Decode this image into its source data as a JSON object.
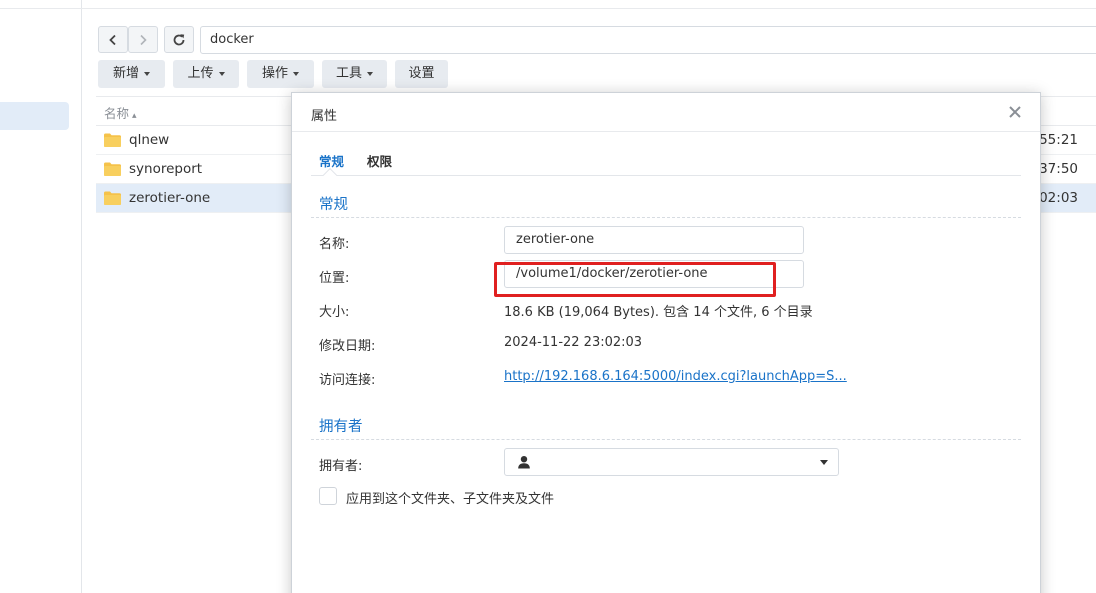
{
  "navigation": {
    "path": "docker"
  },
  "toolbar": {
    "new_label": "新增",
    "upload_label": "上传",
    "action_label": "操作",
    "tools_label": "工具",
    "settings_label": "设置"
  },
  "file_list": {
    "column_name": "名称",
    "sort_indicator": "▴",
    "rows": [
      {
        "name": "qlnew",
        "time": "55:21",
        "icon": "folder-icon"
      },
      {
        "name": "synoreport",
        "time": "37:50",
        "icon": "folder-icon"
      },
      {
        "name": "zerotier-one",
        "time": "02:03",
        "icon": "folder-icon",
        "selected": true
      }
    ]
  },
  "dialog": {
    "title": "属性",
    "close_icon": "close-icon",
    "tabs": [
      {
        "label": "常规",
        "active": true
      },
      {
        "label": "权限",
        "active": false
      }
    ],
    "general": {
      "section_title": "常规",
      "name_label": "名称:",
      "name_value": "zerotier-one",
      "location_label": "位置:",
      "location_value": "/volume1/docker/zerotier-one",
      "size_label": "大小:",
      "size_value": "18.6 KB (19,064 Bytes). 包含 14 个文件,  6 个目录",
      "modified_label": "修改日期:",
      "modified_value": "2024-11-22 23:02:03",
      "link_label": "访问连接:",
      "link_value": "http://192.168.6.164:5000/index.cgi?launchApp=S..."
    },
    "owner": {
      "section_title": "拥有者",
      "owner_label": "拥有者:",
      "owner_value": "",
      "apply_label": "应用到这个文件夹、子文件夹及文件",
      "apply_checked": false
    }
  },
  "colors": {
    "accent": "#1a73c8",
    "highlight_box": "#e02020",
    "selected_row": "#e2ecf8",
    "folder": "#f5c24a"
  }
}
